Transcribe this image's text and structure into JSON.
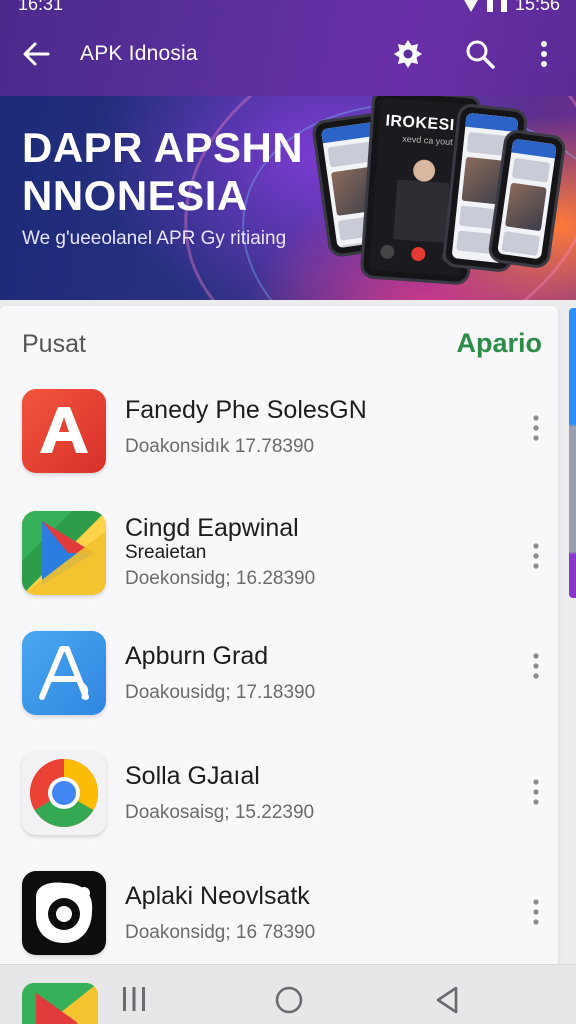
{
  "status_bar": {
    "time": "16:31",
    "clock_right": "15:56"
  },
  "app_bar": {
    "title": "APK Idnosia"
  },
  "banner": {
    "heading_line1": "DAPR APSHN",
    "heading_line2": "NNONESIA",
    "subtitle": "We g'ueeolanel APR Gy ritiaing",
    "phone_title": "IROKESI",
    "phone_subtitle": "xevd ca yout"
  },
  "section": {
    "title": "Pusat",
    "link": "Apario"
  },
  "apps": [
    {
      "name": "Fanedy Phe SolesGN",
      "subtitle": "",
      "meta": "Doakonsidık 17.78390",
      "icon": "letter-a-red-icon"
    },
    {
      "name": "Cingd Eapwinal",
      "subtitle": "Sreaietan",
      "meta": "Doekonsidg; 16.28390",
      "icon": "play-triangle-icon"
    },
    {
      "name": "Apburn Grad",
      "subtitle": "",
      "meta": "Doakousidg; 17.18390",
      "icon": "letter-a-blue-icon"
    },
    {
      "name": "Solla GJaıal",
      "subtitle": "",
      "meta": "Doakosaisg; 15.22390",
      "icon": "chrome-icon"
    },
    {
      "name": "Aplaki Neovlsatk",
      "subtitle": "",
      "meta": "Doakonsidg; 16 78390",
      "icon": "camera-ring-icon"
    }
  ],
  "colors": {
    "accent": "#5a2f9c",
    "link_green": "#2e8c4a"
  }
}
